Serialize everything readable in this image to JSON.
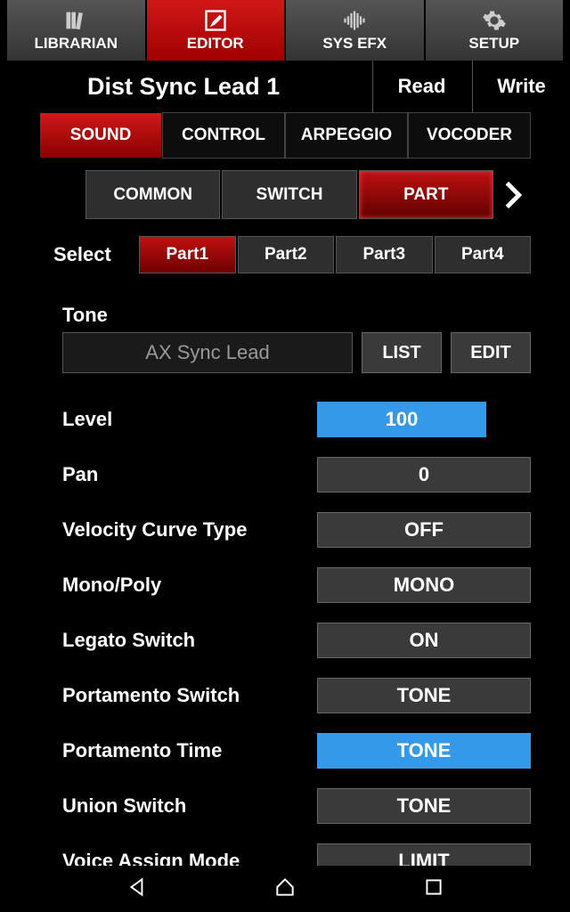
{
  "topTabs": {
    "librarian": "LIBRARIAN",
    "editor": "EDITOR",
    "sysEfx": "SYS EFX",
    "setup": "SETUP"
  },
  "header": {
    "presetName": "Dist Sync Lead 1",
    "read": "Read",
    "write": "Write"
  },
  "soundTabs": {
    "sound": "SOUND",
    "control": "CONTROL",
    "arpeggio": "ARPEGGIO",
    "vocoder": "VOCODER"
  },
  "subTabs": {
    "common": "COMMON",
    "switch": "SWITCH",
    "part": "PART"
  },
  "select": {
    "label": "Select",
    "parts": [
      "Part1",
      "Part2",
      "Part3",
      "Part4"
    ]
  },
  "tone": {
    "label": "Tone",
    "value": "AX Sync Lead",
    "list": "LIST",
    "edit": "EDIT"
  },
  "params": [
    {
      "label": "Level",
      "value": "100",
      "highlight": true,
      "filled": true
    },
    {
      "label": "Pan",
      "value": "0",
      "highlight": false,
      "filled": false
    },
    {
      "label": "Velocity Curve Type",
      "value": "OFF",
      "highlight": false,
      "filled": false
    },
    {
      "label": "Mono/Poly",
      "value": "MONO",
      "highlight": false,
      "filled": false
    },
    {
      "label": "Legato Switch",
      "value": "ON",
      "highlight": false,
      "filled": false
    },
    {
      "label": "Portamento Switch",
      "value": "TONE",
      "highlight": false,
      "filled": false
    },
    {
      "label": "Portamento Time",
      "value": "TONE",
      "highlight": true,
      "filled": false
    },
    {
      "label": "Union Switch",
      "value": "TONE",
      "highlight": false,
      "filled": false
    },
    {
      "label": "Voice Assign Mode",
      "value": "LIMIT",
      "highlight": false,
      "filled": false
    }
  ]
}
